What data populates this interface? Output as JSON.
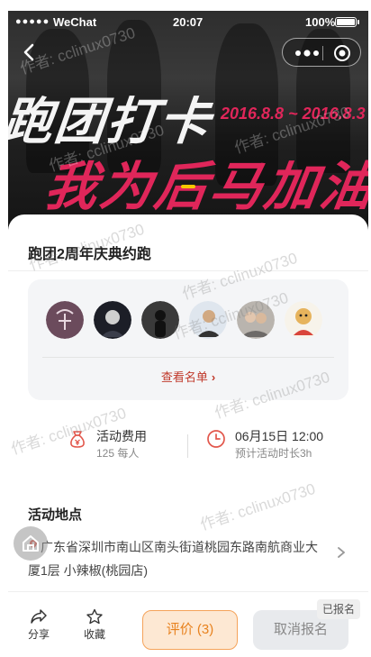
{
  "status_bar": {
    "signal": "●●●●●",
    "carrier": "WeChat",
    "time": "20:07",
    "battery": "100%"
  },
  "banner": {
    "line1": "跑团打卡",
    "line2": "我为后马加油",
    "date": "2016.8.8 ~ 2016.8.3"
  },
  "event": {
    "title": "跑团2周年庆典约跑",
    "view_list_label": "查看名单",
    "fee": {
      "label": "活动费用",
      "value": "125 每人"
    },
    "time": {
      "label": "06月15日 12:00",
      "value": "预计活动时长3h"
    },
    "location_title": "活动地点",
    "address": "广东省深圳市南山区南头街道桃园东路南航商业大厦1层 小辣椒(桃园店)"
  },
  "watermark": "作者: cclinux0730",
  "bottom_bar": {
    "share": "分享",
    "favorite": "收藏",
    "review": "评价 (3)",
    "cancel": "取消报名",
    "badge": "已报名"
  },
  "colors": {
    "accent": "#e0265a",
    "orange": "#e8821e",
    "link_red": "#c0392b"
  }
}
